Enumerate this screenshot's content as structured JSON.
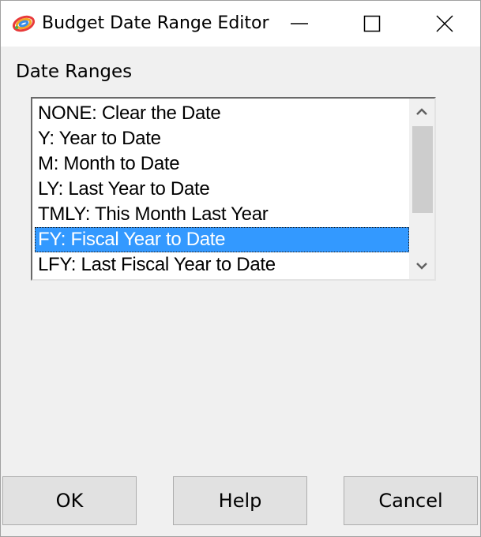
{
  "window": {
    "title": "Budget Date Range Editor",
    "app_icon": "rainbow-brush-icon",
    "controls": {
      "minimize_icon": "minimize-icon",
      "maximize_icon": "maximize-icon",
      "close_icon": "close-icon"
    }
  },
  "group": {
    "label": "Date Ranges"
  },
  "list": {
    "items": [
      "NONE: Clear the Date",
      "Y: Year to Date",
      "M: Month to Date",
      "LY: Last Year to Date",
      "TMLY: This Month Last Year",
      "FY: Fiscal Year to Date",
      "LFY: Last Fiscal Year to Date"
    ],
    "selected": "FY: Fiscal Year to Date",
    "selection_color": "#3399ff",
    "scrollbar": {
      "up_icon": "chevron-up-icon",
      "down_icon": "chevron-down-icon"
    }
  },
  "buttons": {
    "ok": "OK",
    "help": "Help",
    "cancel": "Cancel"
  }
}
